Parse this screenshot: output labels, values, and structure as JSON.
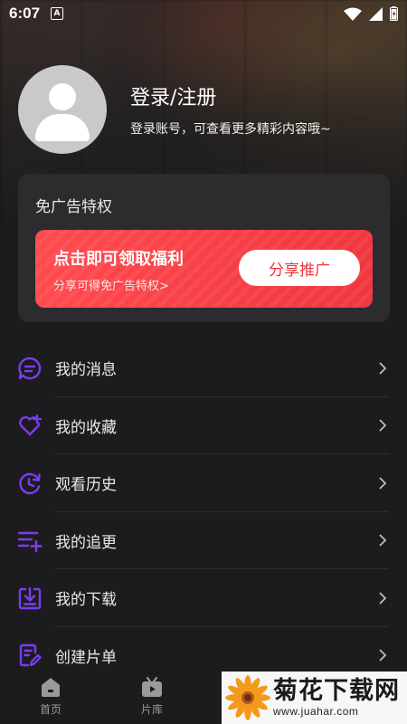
{
  "status_bar": {
    "time": "6:07",
    "notif_letter": "A"
  },
  "profile": {
    "title": "登录/注册",
    "subtitle": "登录账号，可查看更多精彩内容哦~"
  },
  "ad_card": {
    "title": "免广告特权",
    "banner_title": "点击即可领取福利",
    "banner_sub": "分享可得免广告特权>",
    "share_button": "分享推广"
  },
  "menu": {
    "items": [
      {
        "label": "我的消息",
        "icon": "message-icon"
      },
      {
        "label": "我的收藏",
        "icon": "heart-icon"
      },
      {
        "label": "观看历史",
        "icon": "history-icon"
      },
      {
        "label": "我的追更",
        "icon": "playlist-add-icon"
      },
      {
        "label": "我的下载",
        "icon": "download-icon"
      },
      {
        "label": "创建片单",
        "icon": "edit-list-icon"
      }
    ]
  },
  "tabbar": {
    "tabs": [
      {
        "label": "首页"
      },
      {
        "label": "片库"
      }
    ]
  },
  "watermark": {
    "title": "菊花下载网",
    "url": "www.juahar.com"
  },
  "colors": {
    "accent": "#7b3cf0",
    "banner": "#f0363e",
    "background": "#1c1c1e"
  }
}
